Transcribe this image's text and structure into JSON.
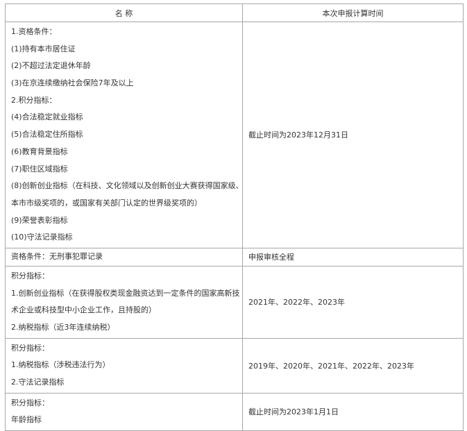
{
  "table": {
    "headers": [
      "名 称",
      "本次申报计算时间"
    ],
    "rows": [
      {
        "name_lines": [
          "1.资格条件：",
          "(1)持有本市居住证",
          "(2)不超过法定退休年龄",
          "(3)在京连续缴纳社会保险7年及以上",
          "2.积分指标：",
          "(4)合法稳定就业指标",
          "(5)合法稳定住所指标",
          "(6)教育背景指标",
          "(7)职住区域指标",
          "(8)创新创业指标（在科技、文化领域以及创新创业大赛获得国家级、",
          "本市市级奖项的，或国家有关部门认定的世界级奖项的）",
          "(9)荣誉表彰指标",
          "(10)守法记录指标"
        ],
        "time": "截止时间为2023年12月31日"
      },
      {
        "name_lines": [
          "资格条件：无刑事犯罪记录"
        ],
        "time": "申报审核全程"
      },
      {
        "name_lines": [
          "积分指标：",
          "1.创新创业指标（在获得股权类现金融资达到一定条件的国家高新技",
          "术企业或科技型中小企业工作，且持股的）",
          "2.纳税指标（近3年连续纳税）"
        ],
        "time": "2021年、2022年、2023年"
      },
      {
        "name_lines": [
          "积分指标：",
          "1.纳税指标（涉税违法行为）",
          "2.守法记录指标"
        ],
        "time": "2019年、2020年、2021年、2022年、2023年"
      },
      {
        "name_lines": [
          "积分指标：",
          "年龄指标"
        ],
        "time": "截止时间为2023年1月1日"
      }
    ]
  }
}
